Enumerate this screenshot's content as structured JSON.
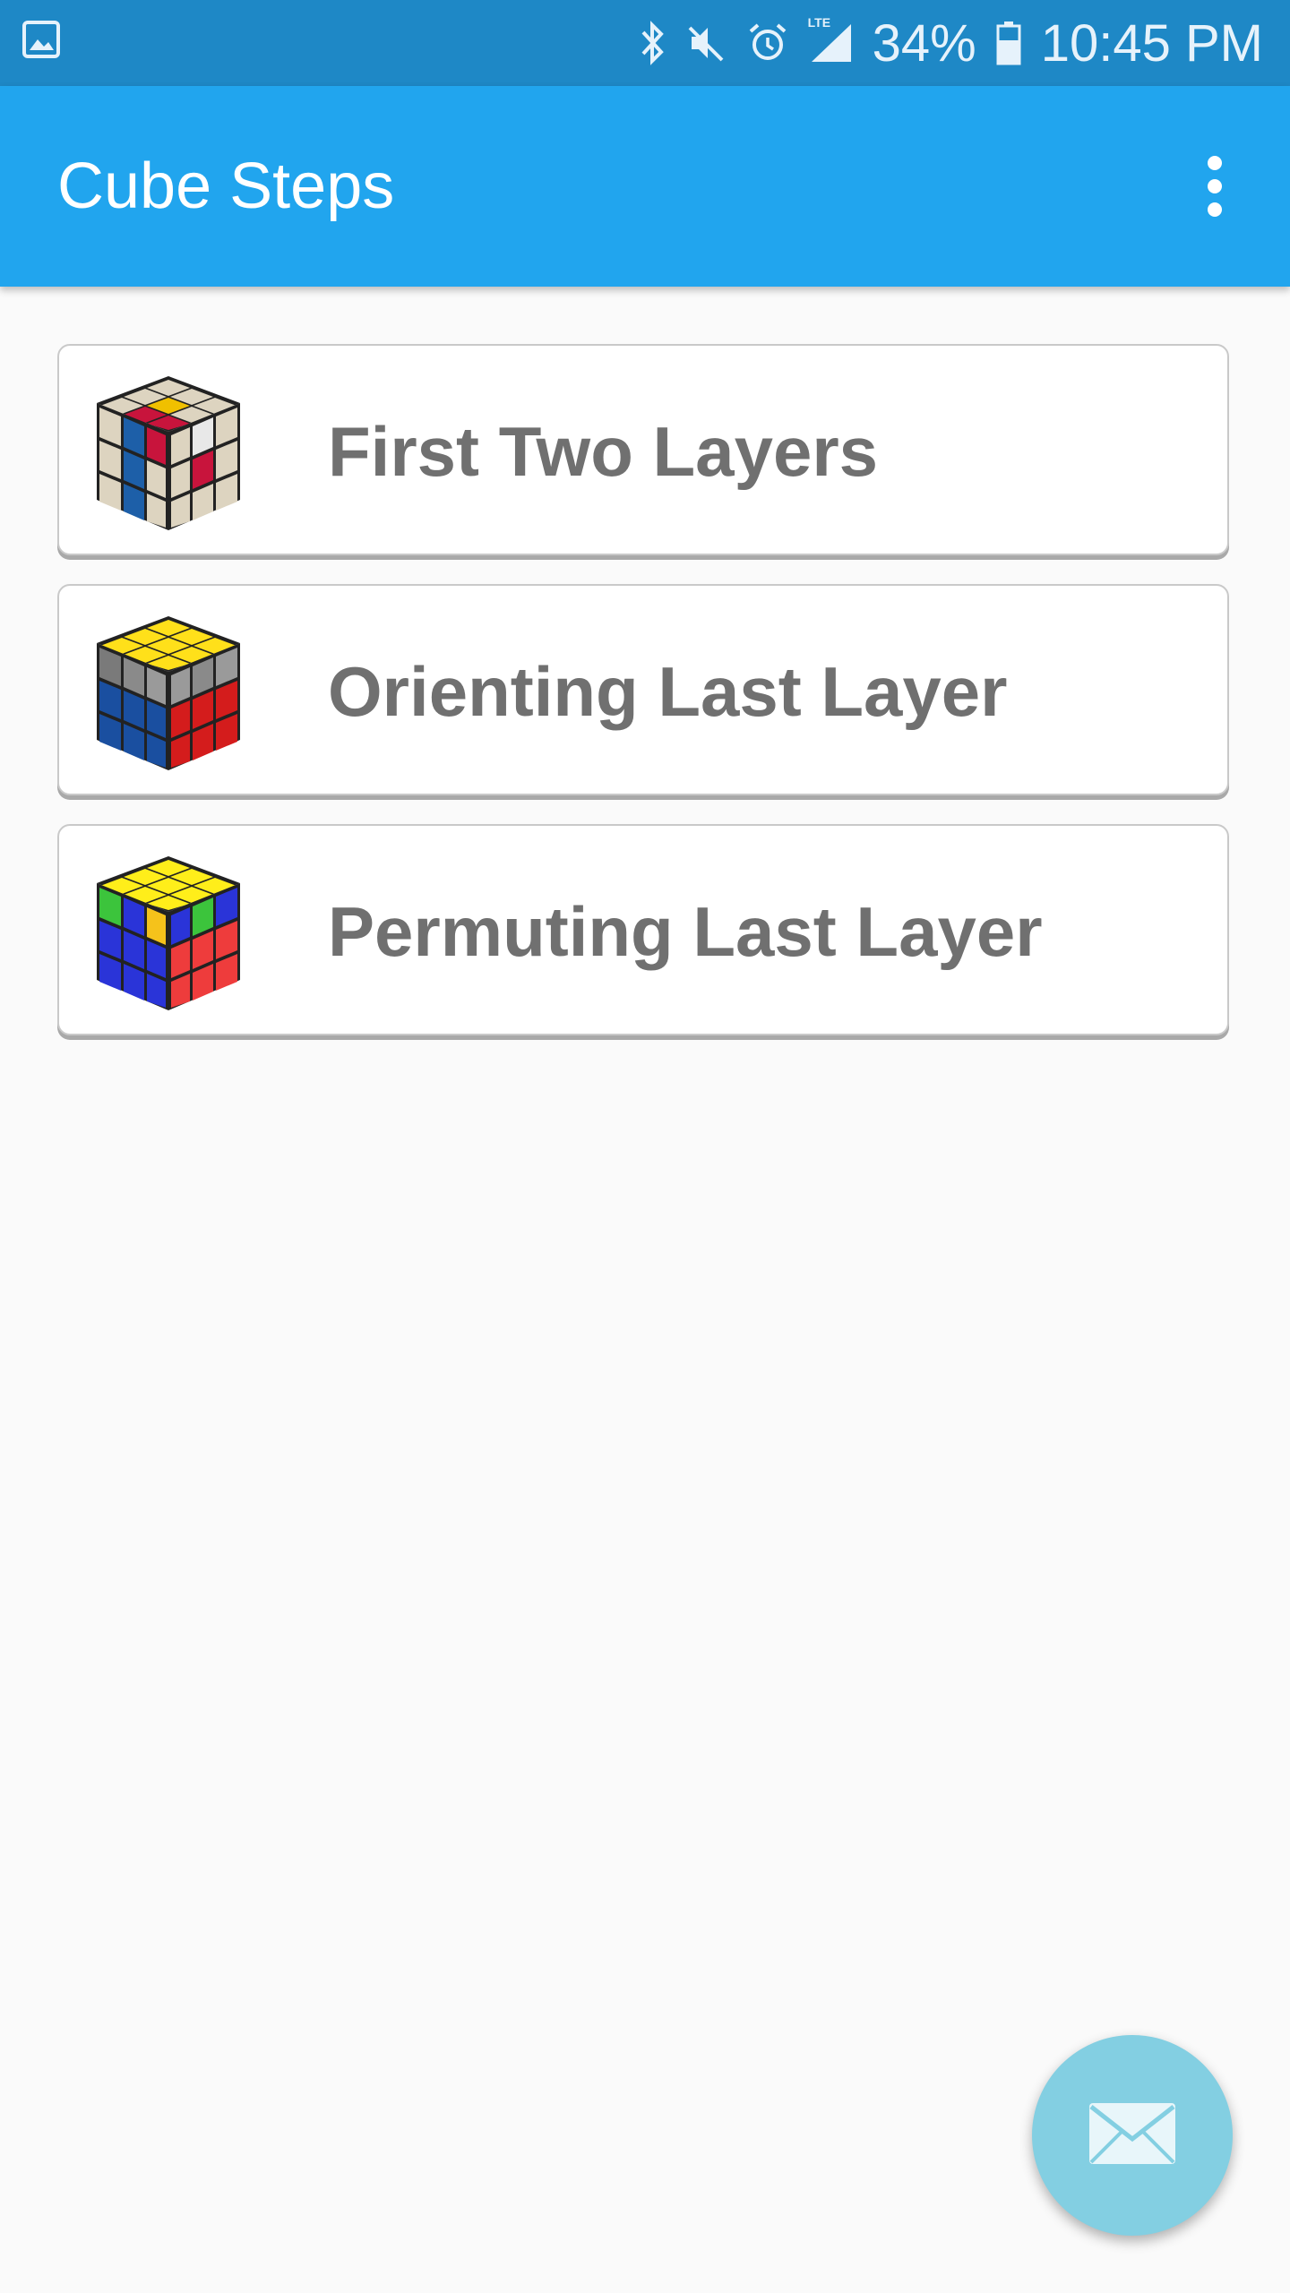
{
  "status_bar": {
    "battery": "34%",
    "time": "10:45 PM",
    "network": "LTE",
    "icons": [
      "gallery-icon",
      "bluetooth-icon",
      "mute-icon",
      "alarm-icon",
      "signal-icon",
      "battery-icon"
    ]
  },
  "app_bar": {
    "title": "Cube Steps",
    "overflow_icon": "more-vert-icon"
  },
  "steps": [
    {
      "label": "First Two Layers",
      "icon": "cube-f2l-icon"
    },
    {
      "label": "Orienting Last Layer",
      "icon": "cube-oll-icon"
    },
    {
      "label": "Permuting Last Layer",
      "icon": "cube-pll-icon"
    }
  ],
  "fab": {
    "icon": "email-icon"
  },
  "colors": {
    "status_bar": "#1e88c6",
    "app_bar": "#21a5ee",
    "fab": "#83cfe2",
    "card_text": "#707070",
    "background": "#fafafa"
  }
}
